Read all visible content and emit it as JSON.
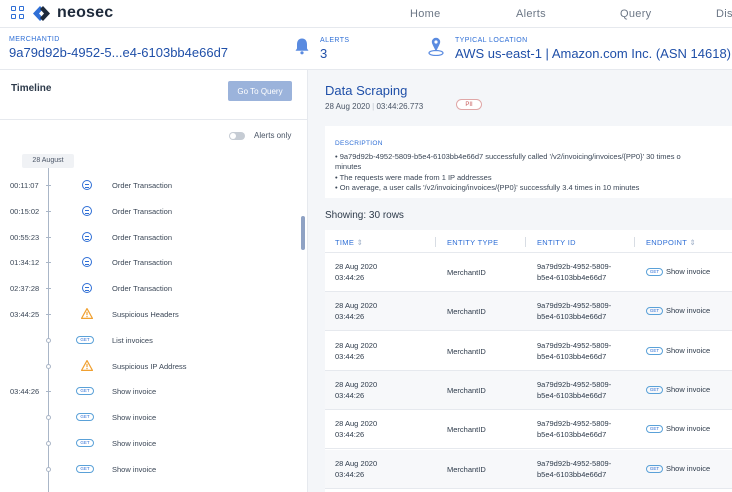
{
  "brand": {
    "name": "neosec"
  },
  "nav": [
    "Home",
    "Alerts",
    "Query",
    "Dis"
  ],
  "info": {
    "merchant_caption": "MERCHANTID",
    "merchant_value": "9a79d92b-4952-5...e4-6103bb4e66d7",
    "alerts_caption": "ALERTS",
    "alerts_value": "3",
    "location_caption": "TYPICAL LOCATION",
    "location_value": "AWS us-east-1 | Amazon.com Inc. (ASN 14618)"
  },
  "timeline": {
    "title": "Timeline",
    "go_to_query": "Go To Query",
    "alerts_only": "Alerts only",
    "date_chip": "28 August",
    "rows": [
      {
        "time": "00:11:07",
        "icon": "circle-icon",
        "label": "Order Transaction"
      },
      {
        "time": "00:15:02",
        "icon": "circle-icon",
        "label": "Order Transaction"
      },
      {
        "time": "00:55:23",
        "icon": "circle-icon",
        "label": "Order Transaction"
      },
      {
        "time": "01:34:12",
        "icon": "circle-icon",
        "label": "Order Transaction"
      },
      {
        "time": "02:37:28",
        "icon": "circle-icon",
        "label": "Order Transaction"
      },
      {
        "time": "03:44:25",
        "icon": "warning-icon",
        "label": "Suspicious Headers"
      },
      {
        "time": "",
        "icon": "get-badge",
        "badge": "GET",
        "label": "List invoices"
      },
      {
        "time": "",
        "icon": "warning-icon",
        "label": "Suspicious IP Address"
      },
      {
        "time": "03:44:26",
        "icon": "get-badge",
        "badge": "GET",
        "label": "Show invoice"
      },
      {
        "time": "",
        "icon": "get-badge",
        "badge": "GET",
        "label": "Show invoice"
      },
      {
        "time": "",
        "icon": "get-badge",
        "badge": "GET",
        "label": "Show invoice"
      },
      {
        "time": "",
        "icon": "get-badge",
        "badge": "GET",
        "label": "Show invoice"
      }
    ]
  },
  "detail": {
    "title": "Data Scraping",
    "date": "28 Aug 2020",
    "time": "03:44:26.773",
    "badge": "PII",
    "description_caption": "DESCRIPTION",
    "description_lines": [
      "• 9a79d92b-4952-5809-b5e4-6103bb4e66d7 successfully called '/v2/invoicing/invoices/{PP0}' 30 times o",
      "minutes",
      "• The requests were made from 1 IP addresses",
      "• On average, a user calls '/v2/invoicing/invoices/{PP0}' successfully 3.4 times in 10 minutes"
    ],
    "showing": "Showing: 30 rows",
    "columns": [
      "TIME",
      "ENTITY TYPE",
      "ENTITY ID",
      "ENDPOINT"
    ],
    "rows": [
      {
        "time1": "28 Aug 2020",
        "time2": "03:44:26",
        "type": "MerchantID",
        "id1": "9a79d92b-4952-5809-",
        "id2": "b5e4-6103bb4e66d7",
        "method": "GET",
        "endpoint": "Show invoice"
      },
      {
        "time1": "28 Aug 2020",
        "time2": "03:44:26",
        "type": "MerchantID",
        "id1": "9a79d92b-4952-5809-",
        "id2": "b5e4-6103bb4e66d7",
        "method": "GET",
        "endpoint": "Show invoice"
      },
      {
        "time1": "28 Aug 2020",
        "time2": "03:44:26",
        "type": "MerchantID",
        "id1": "9a79d92b-4952-5809-",
        "id2": "b5e4-6103bb4e66d7",
        "method": "GET",
        "endpoint": "Show invoice"
      },
      {
        "time1": "28 Aug 2020",
        "time2": "03:44:26",
        "type": "MerchantID",
        "id1": "9a79d92b-4952-5809-",
        "id2": "b5e4-6103bb4e66d7",
        "method": "GET",
        "endpoint": "Show invoice"
      },
      {
        "time1": "28 Aug 2020",
        "time2": "03:44:26",
        "type": "MerchantID",
        "id1": "9a79d92b-4952-5809-",
        "id2": "b5e4-6103bb4e66d7",
        "method": "GET",
        "endpoint": "Show invoice"
      },
      {
        "time1": "28 Aug 2020",
        "time2": "03:44:26",
        "type": "MerchantID",
        "id1": "9a79d92b-4952-5809-",
        "id2": "b5e4-6103bb4e66d7",
        "method": "GET",
        "endpoint": "Show invoice"
      }
    ]
  },
  "colors": {
    "accent": "#2f6fd6",
    "title_blue": "#1f4fa8",
    "warning": "#f0a030",
    "pii": "#c75a5a"
  }
}
